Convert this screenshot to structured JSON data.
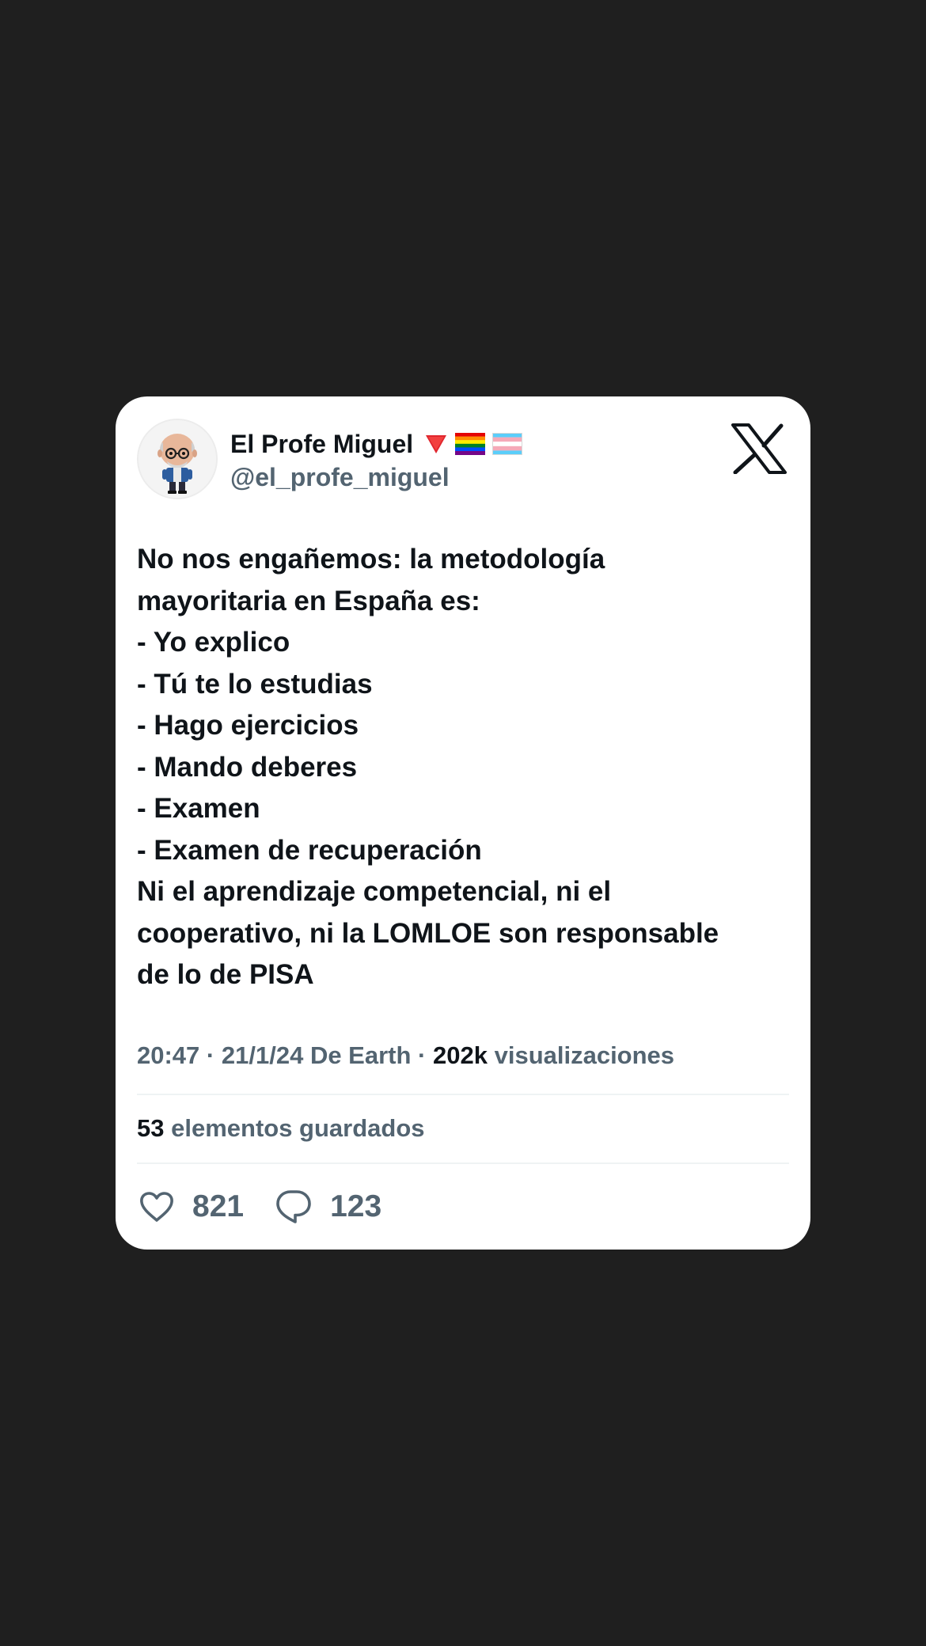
{
  "tweet": {
    "author": {
      "display_name": "El Profe Miguel",
      "handle": "@el_profe_miguel",
      "badges": [
        "red-triangle-icon",
        "rainbow-flag-icon",
        "transgender-flag-icon"
      ]
    },
    "text_lines": [
      "No nos engañemos: la metodología",
      "mayoritaria en España es:",
      "- Yo explico",
      "- Tú te lo estudias",
      "- Hago ejercicios",
      "- Mando deberes",
      "- Examen",
      "- Examen de recuperación",
      "Ni el aprendizaje competencial, ni el",
      "cooperativo, ni la LOMLOE son responsable",
      "de lo de PISA"
    ],
    "meta": {
      "time": "20:47",
      "separator": "·",
      "date": "21/1/24",
      "source": "De Earth",
      "views_count": "202k",
      "views_label": "visualizaciones"
    },
    "saved": {
      "count": "53",
      "label": "elementos guardados"
    },
    "actions": {
      "likes": "821",
      "replies": "123"
    }
  },
  "colors": {
    "background": "#1f1f1f",
    "card": "#ffffff",
    "text_primary": "#0f1419",
    "text_secondary": "#536471",
    "divider": "#eff3f4"
  }
}
